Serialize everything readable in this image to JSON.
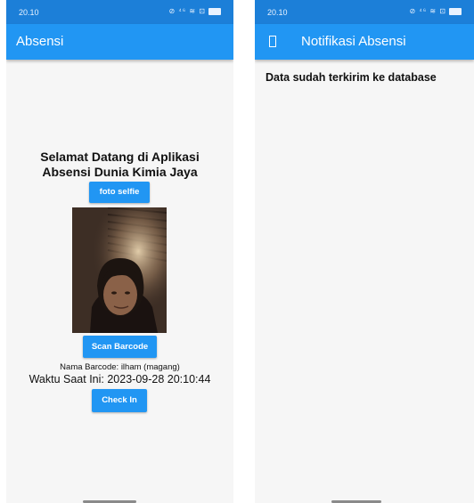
{
  "left_screen": {
    "status": {
      "time": "20.10",
      "icons": "⊘ ⁴⁶ ≋ ⊡"
    },
    "app_bar": {
      "title": "Absensi"
    },
    "welcome_text": "Selamat Datang di Aplikasi Absensi Dunia Kimia Jaya",
    "buttons": {
      "selfie": "foto selfie",
      "scan": "Scan Barcode",
      "check_in": "Check In"
    },
    "barcode_name": "Nama Barcode: ilham (magang)",
    "current_time": "Waktu Saat Ini: 2023-09-28 20:10:44"
  },
  "right_screen": {
    "status": {
      "time": "20.10",
      "icons": "⊘ ⁴⁶ ≋ ⊡"
    },
    "app_bar": {
      "title": "Notifikasi Absensi"
    },
    "message": "Data sudah terkirim ke database"
  }
}
